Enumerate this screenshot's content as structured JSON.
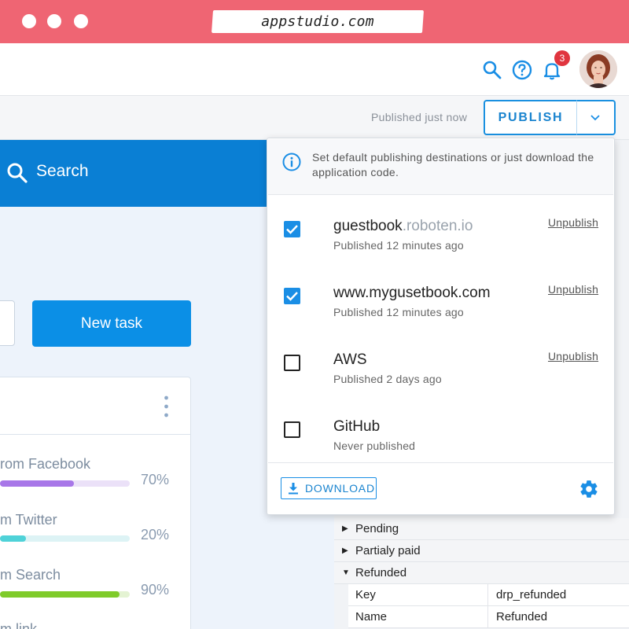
{
  "browser": {
    "url": "appstudio.com",
    "window_controls": [
      "close",
      "minimize",
      "maximize"
    ]
  },
  "header": {
    "icons": [
      "search-icon",
      "help-icon",
      "bell-icon"
    ],
    "notification_count": "3",
    "accent_color": "#1a8ee5"
  },
  "toolbar": {
    "publish_status": "Published just now",
    "publish_label": "PUBLISH"
  },
  "app": {
    "search_label": "Search",
    "new_task_label": "New task",
    "sources": [
      {
        "label": "rom Facebook",
        "percent": "70%",
        "value": 0.57,
        "fill": "#a877e8",
        "track": "#ebe1f8"
      },
      {
        "label": "m Twitter",
        "percent": "20%",
        "value": 0.2,
        "fill": "#4fd2d8",
        "track": "#ddf3f5"
      },
      {
        "label": "m Search",
        "percent": "90%",
        "value": 0.92,
        "fill": "#7fcb2a",
        "track": "#e4f3d3"
      },
      {
        "label": "m link",
        "percent": "",
        "value": 0,
        "fill": "#cccccc",
        "track": "#eeeeee"
      }
    ]
  },
  "publish_menu": {
    "info": "Set default publishing destinations or just download the application code.",
    "destinations": [
      {
        "name": "guestbook",
        "name_suffix": ".roboten.io",
        "status": "Published 12 minutes ago",
        "checked": true,
        "action": "Unpublish"
      },
      {
        "name": "www.mygusetbook.com",
        "name_suffix": "",
        "status": "Published 12 minutes ago",
        "checked": true,
        "action": "Unpublish"
      },
      {
        "name": "AWS",
        "name_suffix": "",
        "status": "Published 2 days ago",
        "checked": false,
        "action": "Unpublish"
      },
      {
        "name": "GitHub",
        "name_suffix": "",
        "status": "Never published",
        "checked": false,
        "action": ""
      }
    ],
    "download_label": "DOWNLOAD"
  },
  "tree": {
    "rows": [
      {
        "label": "Pending",
        "expanded": false
      },
      {
        "label": "Partialy paid",
        "expanded": false
      },
      {
        "label": "Refunded",
        "expanded": true
      }
    ],
    "details": [
      {
        "key": "Key",
        "value": "drp_refunded"
      },
      {
        "key": "Name",
        "value": "Refunded"
      }
    ]
  }
}
